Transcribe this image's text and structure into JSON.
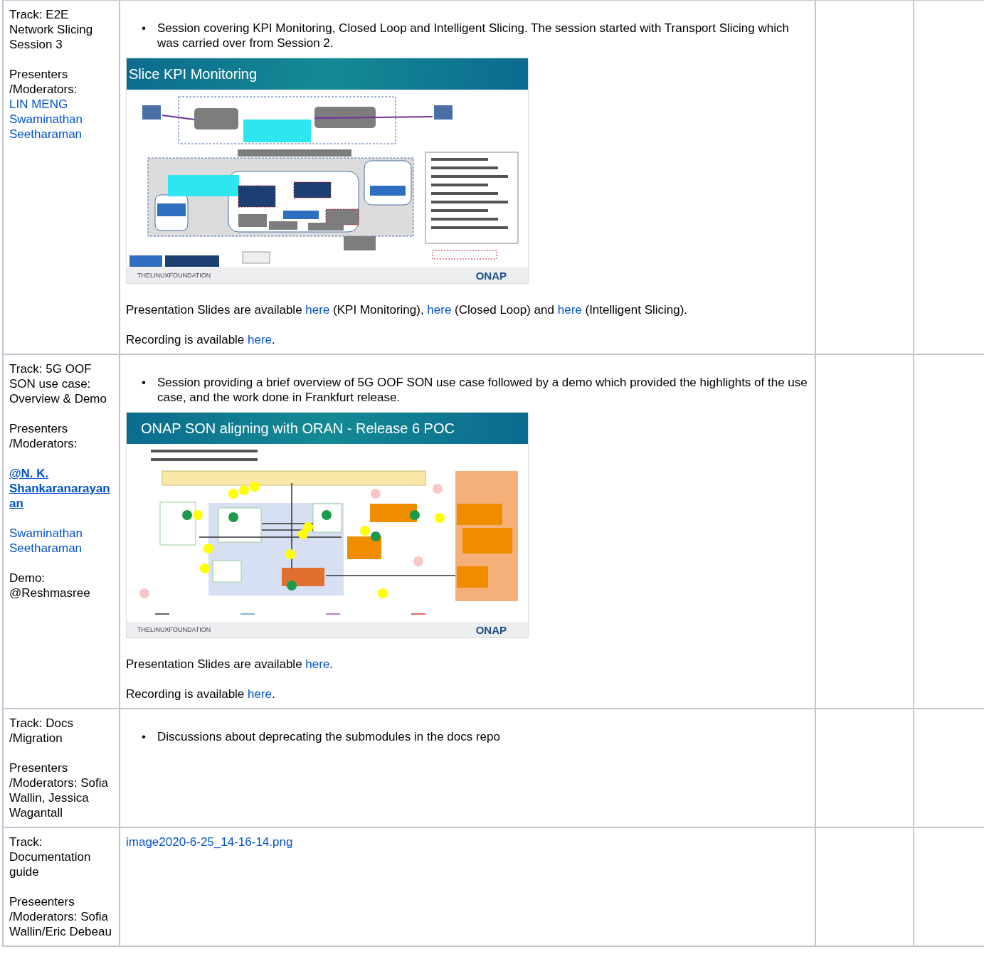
{
  "rows": [
    {
      "track": [
        [
          {
            "kind": "text",
            "text": "Track: E2E Network Slicing Session 3"
          }
        ],
        [
          {
            "kind": "text",
            "text": "Presenters /Moderators: "
          },
          {
            "kind": "link",
            "text": "LIN MENG Swaminathan Seetharaman"
          }
        ]
      ],
      "bullets": [
        {
          "marker": "•",
          "text": "Session covering KPI Monitoring, Closed Loop and Intelligent Slicing. The session started with Transport Slicing which was carried over from Session 2."
        }
      ],
      "slide": {
        "kind": "architecture",
        "title": "Slice KPI Monitoring",
        "footer_left": "THELINUXFOUNDATION",
        "footer_right": "ONAP"
      },
      "paragraphs": [
        [
          {
            "kind": "text",
            "text": "Presentation Slides are available "
          },
          {
            "kind": "link",
            "text": "here"
          },
          {
            "kind": "text",
            "text": " (KPI Monitoring), "
          },
          {
            "kind": "link",
            "text": "here"
          },
          {
            "kind": "text",
            "text": " (Closed Loop) and "
          },
          {
            "kind": "link",
            "text": "here"
          },
          {
            "kind": "text",
            "text": " (Intelligent Slicing)."
          }
        ],
        [
          {
            "kind": "text",
            "text": "Recording is available "
          },
          {
            "kind": "link",
            "text": "here"
          },
          {
            "kind": "text",
            "text": "."
          }
        ]
      ]
    },
    {
      "track": [
        [
          {
            "kind": "text",
            "text": "Track: 5G OOF SON use case: Overview & Demo"
          }
        ],
        [
          {
            "kind": "text",
            "text": "Presenters /Moderators:"
          }
        ],
        [
          {
            "kind": "mention",
            "text": "@N. K. Shankaranarayanan"
          }
        ],
        [
          {
            "kind": "link",
            "text": "Swaminathan Seetharaman"
          }
        ],
        [
          {
            "kind": "text",
            "text": "Demo: @Reshmasree"
          }
        ]
      ],
      "bullets": [
        {
          "marker": "•",
          "text": "Session providing a brief overview of 5G OOF SON use case followed by a demo which provided the highlights of the use case, and the work done in Frankfurt release."
        }
      ],
      "slide": {
        "kind": "flow",
        "title": "ONAP SON aligning with ORAN - Release 6 POC",
        "footer_left": "THELINUXFOUNDATION",
        "footer_right": "ONAP"
      },
      "paragraphs": [
        [
          {
            "kind": "text",
            "text": "Presentation Slides are available "
          },
          {
            "kind": "link",
            "text": "here"
          },
          {
            "kind": "text",
            "text": "."
          }
        ],
        [
          {
            "kind": "text",
            "text": "Recording is available "
          },
          {
            "kind": "link",
            "text": "here"
          },
          {
            "kind": "text",
            "text": "."
          }
        ]
      ]
    },
    {
      "track": [
        [
          {
            "kind": "text",
            "text": "Track: Docs /Migration"
          }
        ],
        [
          {
            "kind": "text",
            "text": "Presenters /Moderators: Sofia Wallin, Jessica Wagantall"
          }
        ]
      ],
      "bullets": [
        {
          "marker": "•",
          "text": "Discussions about deprecating the submodules in the docs repo"
        }
      ]
    },
    {
      "track": [
        [
          {
            "kind": "text",
            "text": "Track: Documentation guide"
          }
        ],
        [
          {
            "kind": "text",
            "text": "Preseenters /Moderators: Sofia Wallin/Eric Debeau"
          }
        ]
      ],
      "paragraphs": [
        [
          {
            "kind": "link",
            "text": "image2020-6-25_14-16-14.png"
          }
        ]
      ]
    }
  ]
}
